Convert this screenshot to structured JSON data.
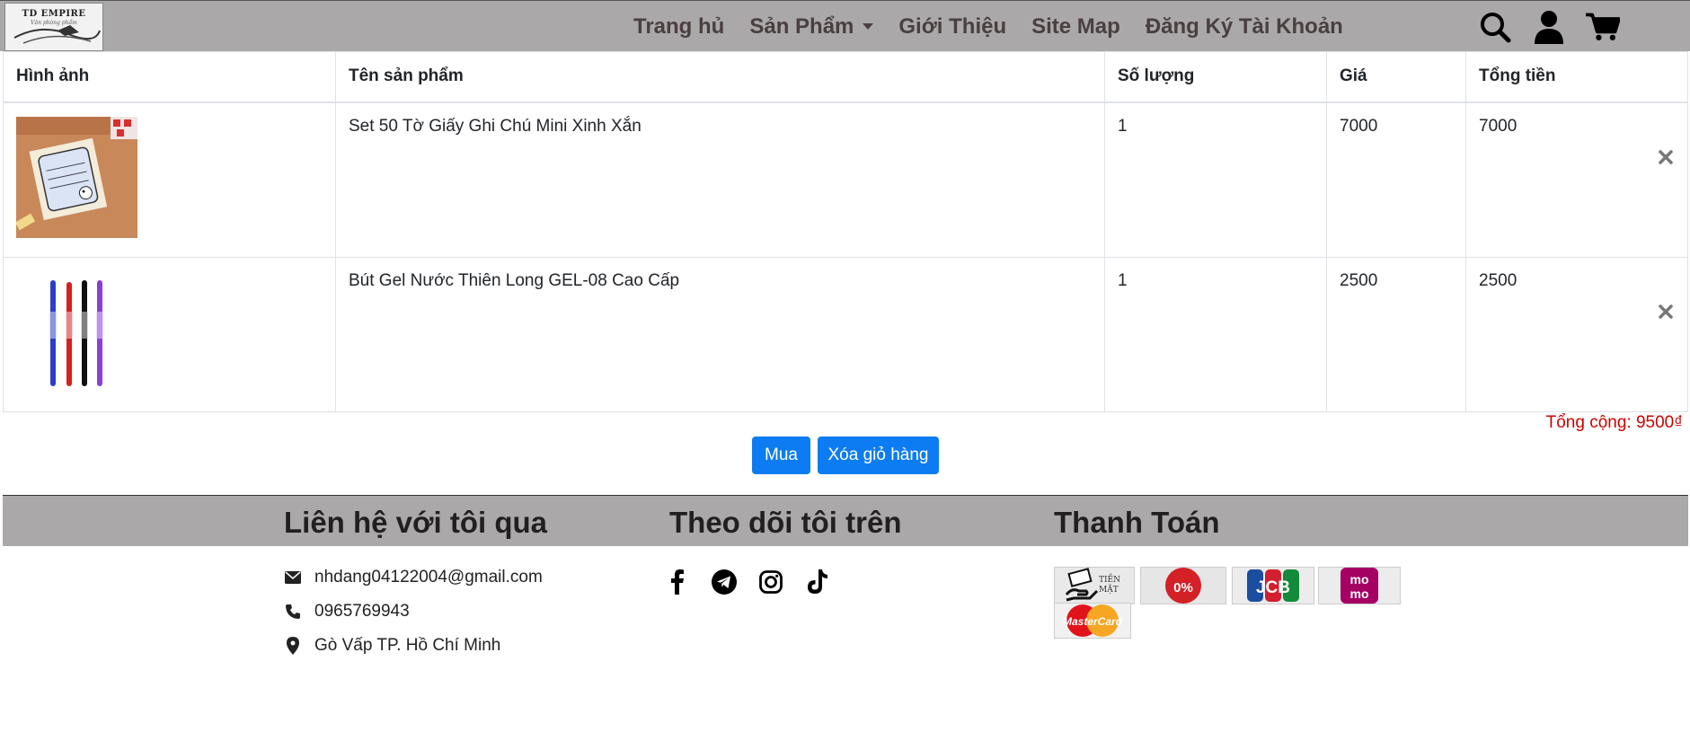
{
  "nav": {
    "logo_text": "TD EMPIRE",
    "logo_sub": "Văn phòng phẩm",
    "links": [
      "Trang hủ",
      "Sản Phẩm",
      "Giới Thiệu",
      "Site Map",
      "Đăng Ký Tài Khoản"
    ],
    "icons": [
      "search-icon",
      "user-icon",
      "cart-icon"
    ]
  },
  "table": {
    "headers": [
      "Hình ảnh",
      "Tên sản phẩm",
      "Số lượng",
      "Giá",
      "Tổng tiền"
    ],
    "rows": [
      {
        "name": "Set 50 Tờ Giấy Ghi Chú Mini Xinh Xắn",
        "qty": "1",
        "price": "7000",
        "total": "7000",
        "image": "sticky-notes-image"
      },
      {
        "name": "Bút Gel Nước Thiên Long GEL-08 Cao Cấp",
        "qty": "1",
        "price": "2500",
        "total": "2500",
        "image": "gel-pens-image"
      }
    ]
  },
  "summary": {
    "total": "Tổng cộng: 9500₫"
  },
  "buttons": {
    "buy": "Mua",
    "clear": "Xóa giỏ hàng"
  },
  "footer": {
    "contact_title": "Liên hệ với tôi qua",
    "follow_title": "Theo dõi tôi trên",
    "payment_title": "Thanh Toán",
    "email": "nhdang04122004@gmail.com",
    "phone": "0965769943",
    "address": "Gò Vấp TP. Hồ Chí Minh",
    "social_icons": [
      "facebook-icon",
      "telegram-icon",
      "instagram-icon",
      "tiktok-icon"
    ],
    "payment_methods": [
      {
        "name": "cash",
        "label": "TIỀN MẶT"
      },
      {
        "name": "installment",
        "label": "0%"
      },
      {
        "name": "jcb",
        "label": "JCB"
      },
      {
        "name": "momo",
        "label": "mo mo"
      },
      {
        "name": "mastercard",
        "label": "MasterCard"
      }
    ]
  },
  "colors": {
    "nav_bg": "#aaa8a9",
    "button_blue": "#0d7cf2",
    "total_red": "#cc0000"
  }
}
